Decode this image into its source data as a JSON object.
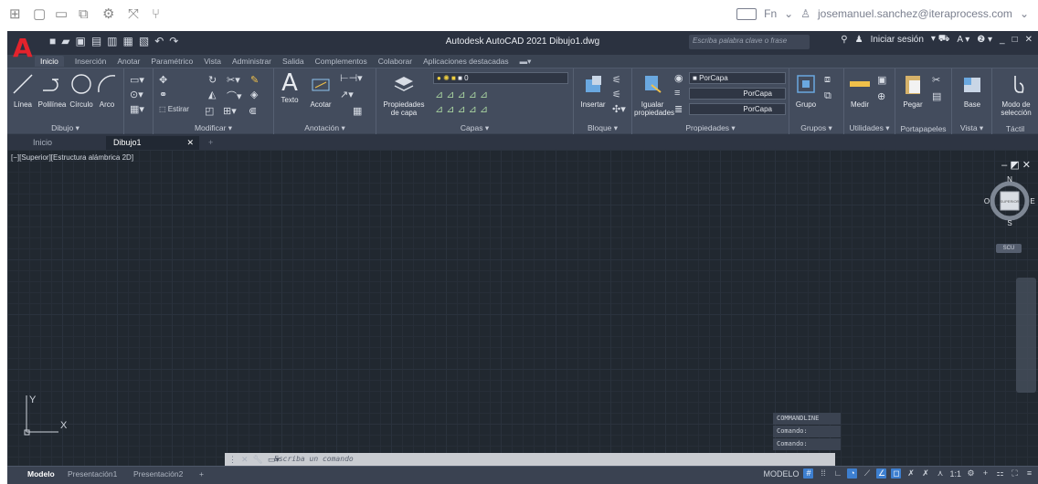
{
  "os": {
    "icons": [
      "grid-icon",
      "window-icon",
      "folder-icon",
      "copy-icon",
      "settings-icon",
      "collapse-icon",
      "branch-icon"
    ],
    "fn_label": "Fn",
    "user": "josemanuel.sanchez@iteraprocess.com"
  },
  "titlebar": {
    "app_title": "Autodesk AutoCAD 2021   Dibujo1.dwg",
    "search_placeholder": "Escriba palabra clave o frase",
    "signin": "Iniciar sesión"
  },
  "ribbon_tabs": [
    "Inicio",
    "Inserción",
    "Anotar",
    "Paramétrico",
    "Vista",
    "Administrar",
    "Salida",
    "Complementos",
    "Colaborar",
    "Aplicaciones destacadas"
  ],
  "panels": {
    "dibujo": {
      "label": "Dibujo ▾",
      "buttons": [
        "Línea",
        "Polilínea",
        "Círculo",
        "Arco"
      ]
    },
    "modificar": {
      "label": "Modificar ▾",
      "estirar": "Estirar"
    },
    "anotacion": {
      "label": "Anotación ▾",
      "buttons": [
        "Texto",
        "Acotar"
      ]
    },
    "capas": {
      "label": "Capas ▾",
      "propiedades": "Propiedades de capa",
      "layer_value": "0"
    },
    "bloque": {
      "label": "Bloque ▾",
      "insertar": "Insertar"
    },
    "propiedades": {
      "label": "Propiedades ▾",
      "igualar": "Igualar propiedades",
      "color": "PorCapa",
      "linetype": "PorCapa",
      "lineweight": "PorCapa"
    },
    "grupos": {
      "label": "Grupos ▾",
      "grupo": "Grupo"
    },
    "utilidades": {
      "label": "Utilidades ▾",
      "medir": "Medir"
    },
    "portapapeles": {
      "label": "Portapapeles",
      "pegar": "Pegar"
    },
    "vista": {
      "label": "Vista ▾",
      "base": "Base"
    },
    "tactil": {
      "label": "Táctil",
      "modo": "Modo de selección"
    }
  },
  "doc_tabs": {
    "inicio": "Inicio",
    "dibujo": "Dibujo1"
  },
  "viewport": {
    "label": "[−][Superior][Estructura alámbrica 2D]",
    "compass": {
      "n": "N",
      "s": "S",
      "e": "E",
      "w": "O",
      "face": "SUPERIOR"
    },
    "ucs_menu": "SCU",
    "axis_y": "Y",
    "axis_x": "X"
  },
  "command": {
    "history": [
      "COMMANDLINE",
      "Comando:",
      "Comando:"
    ],
    "placeholder": "Escriba un comando"
  },
  "layout_tabs": [
    "Modelo",
    "Presentación1",
    "Presentación2"
  ],
  "status": {
    "model": "MODELO",
    "scale": "1:1"
  },
  "colors": {
    "accent_red": "#e3232c",
    "canvas": "#212830",
    "ribbon": "#434c5d"
  }
}
